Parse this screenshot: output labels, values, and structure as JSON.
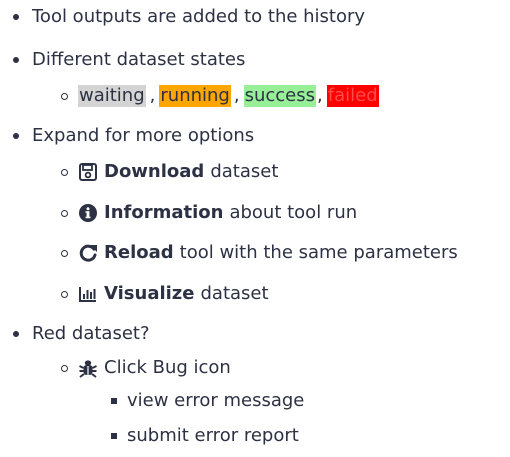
{
  "items": [
    {
      "text": "Tool outputs are added to the history"
    },
    {
      "text": "Different dataset states"
    },
    {
      "states": {
        "waiting": "waiting",
        "running": "running",
        "success": "success",
        "failed": "failed",
        "sep1": ",",
        "sep2": ",",
        "sep3": ","
      },
      "colors": {
        "waiting": "#d4d4d4",
        "running": "#ffa500",
        "success": "#97f097",
        "failed": "#ff0000"
      }
    },
    {
      "text": "Expand for more options"
    },
    {
      "icon": "floppy-disk-icon",
      "bold": "Download",
      "text": "dataset"
    },
    {
      "icon": "info-circle-icon",
      "bold": "Information",
      "text": "about tool run"
    },
    {
      "icon": "redo-icon",
      "bold": "Reload",
      "text": "tool with the same parameters"
    },
    {
      "icon": "bar-chart-icon",
      "bold": "Visualize",
      "text": "dataset"
    },
    {
      "text": "Red dataset?"
    },
    {
      "icon": "bug-icon",
      "text": "Click Bug icon"
    },
    {
      "text": "view error message"
    },
    {
      "text": "submit error report"
    }
  ]
}
